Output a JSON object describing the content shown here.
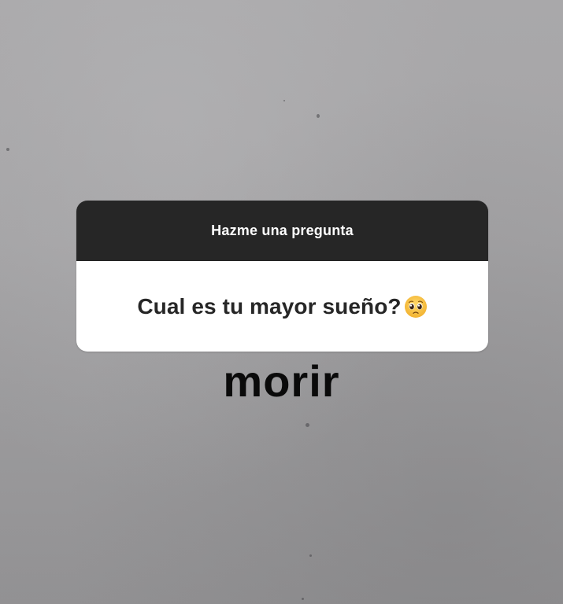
{
  "question_sticker": {
    "header": "Hazme una pregunta",
    "question": "Cual es tu mayor sueño?",
    "emoji": "pleading-face-icon"
  },
  "answer": {
    "text": "morir"
  },
  "colors": {
    "header_bg": "#262626",
    "body_bg": "#ffffff",
    "answer_text": "#0a0a0a"
  }
}
